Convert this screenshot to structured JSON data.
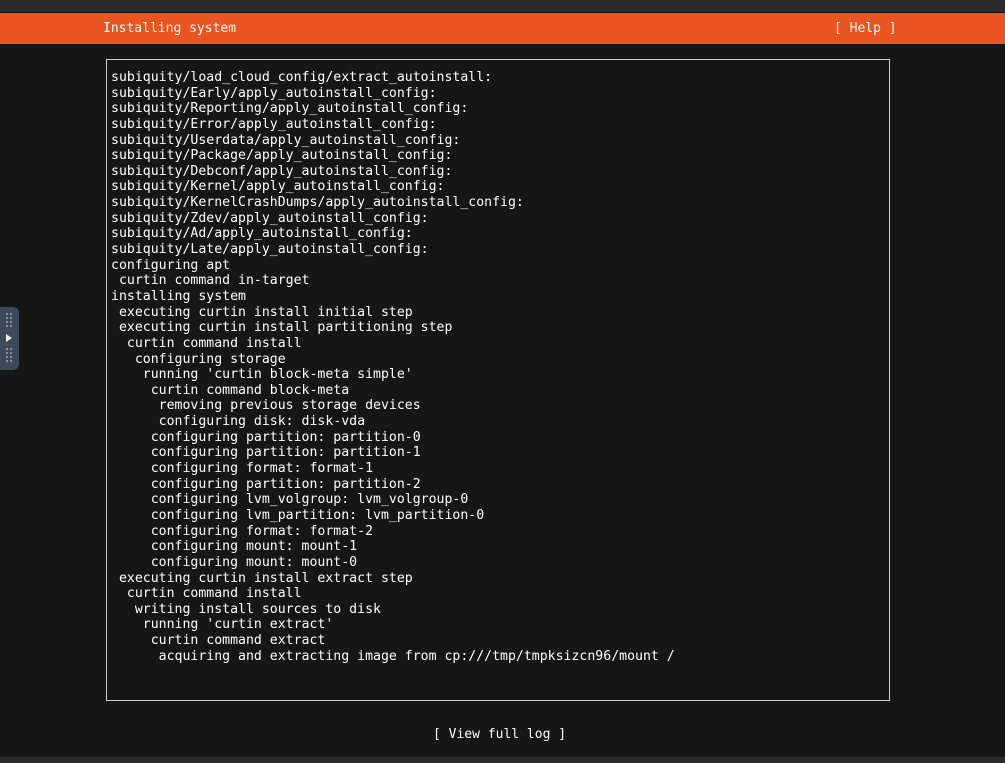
{
  "header": {
    "title": "Installing system",
    "help_label": "[ Help ]"
  },
  "log": {
    "lines": [
      "subiquity/load_cloud_config/extract_autoinstall:",
      "subiquity/Early/apply_autoinstall_config:",
      "subiquity/Reporting/apply_autoinstall_config:",
      "subiquity/Error/apply_autoinstall_config:",
      "subiquity/Userdata/apply_autoinstall_config:",
      "subiquity/Package/apply_autoinstall_config:",
      "subiquity/Debconf/apply_autoinstall_config:",
      "subiquity/Kernel/apply_autoinstall_config:",
      "subiquity/KernelCrashDumps/apply_autoinstall_config:",
      "subiquity/Zdev/apply_autoinstall_config:",
      "subiquity/Ad/apply_autoinstall_config:",
      "subiquity/Late/apply_autoinstall_config:",
      "configuring apt",
      " curtin command in-target",
      "installing system",
      " executing curtin install initial step",
      " executing curtin install partitioning step",
      "  curtin command install",
      "   configuring storage",
      "    running 'curtin block-meta simple'",
      "     curtin command block-meta",
      "      removing previous storage devices",
      "      configuring disk: disk-vda",
      "     configuring partition: partition-0",
      "     configuring partition: partition-1",
      "     configuring format: format-1",
      "     configuring partition: partition-2",
      "     configuring lvm_volgroup: lvm_volgroup-0",
      "     configuring lvm_partition: lvm_partition-0",
      "     configuring format: format-2",
      "     configuring mount: mount-1",
      "     configuring mount: mount-0",
      " executing curtin install extract step",
      "  curtin command install",
      "   writing install sources to disk",
      "    running 'curtin extract'",
      "     curtin command extract",
      "      acquiring and extracting image from cp:///tmp/tmpksizcn96/mount /"
    ]
  },
  "footer": {
    "view_log_label": "[ View full log ]"
  },
  "side_handle": {
    "icon": "play-arrow-icon"
  },
  "colors": {
    "accent": "#e95420",
    "background": "#161616",
    "text": "#ffffff"
  }
}
